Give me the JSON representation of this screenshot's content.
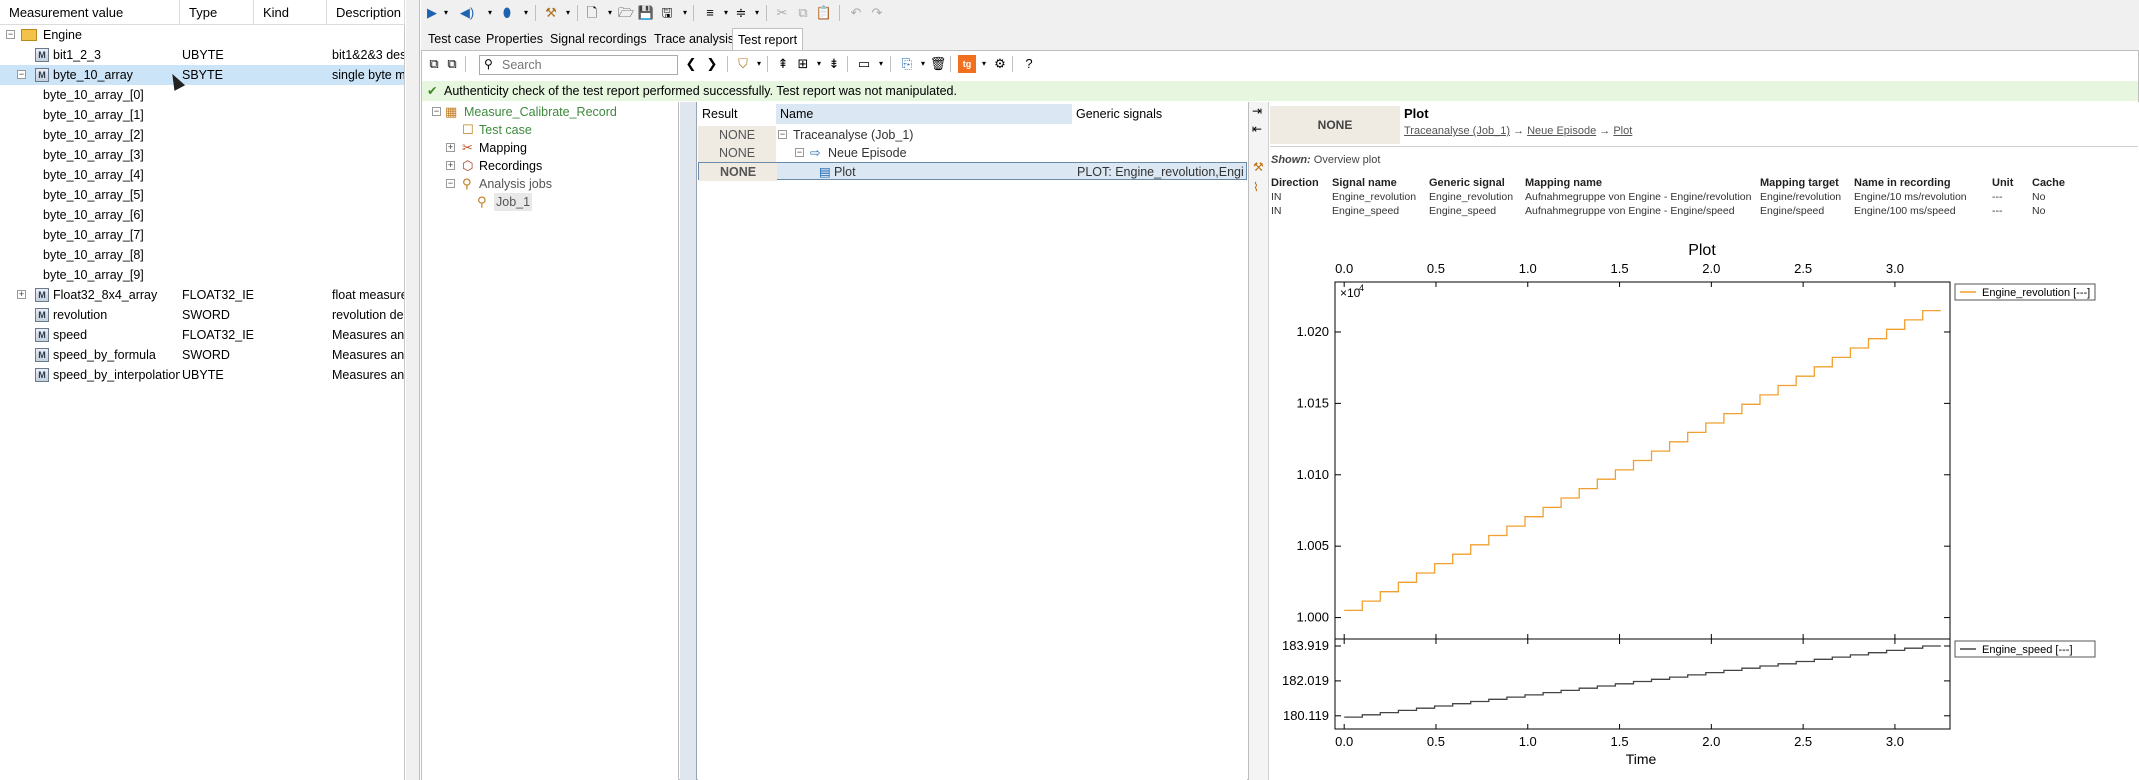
{
  "left_panel": {
    "columns": [
      "Measurement value",
      "Type",
      "Kind",
      "Description"
    ],
    "rows": [
      {
        "name": "Engine",
        "type": "",
        "kind": "",
        "description": "",
        "expander": "⊟",
        "icon": "folder"
      },
      {
        "name": "bit1_2_3",
        "type": "UBYTE",
        "kind": "",
        "description": "bit1&2&3 des",
        "icon": "M"
      },
      {
        "name": "byte_10_array",
        "type": "SBYTE",
        "kind": "",
        "description": "single byte m",
        "expander": "⊟",
        "icon": "M",
        "selected": true
      },
      {
        "name": "byte_10_array_[0]",
        "type": "",
        "kind": "",
        "description": ""
      },
      {
        "name": "byte_10_array_[1]",
        "type": "",
        "kind": "",
        "description": ""
      },
      {
        "name": "byte_10_array_[2]",
        "type": "",
        "kind": "",
        "description": ""
      },
      {
        "name": "byte_10_array_[3]",
        "type": "",
        "kind": "",
        "description": ""
      },
      {
        "name": "byte_10_array_[4]",
        "type": "",
        "kind": "",
        "description": ""
      },
      {
        "name": "byte_10_array_[5]",
        "type": "",
        "kind": "",
        "description": ""
      },
      {
        "name": "byte_10_array_[6]",
        "type": "",
        "kind": "",
        "description": ""
      },
      {
        "name": "byte_10_array_[7]",
        "type": "",
        "kind": "",
        "description": ""
      },
      {
        "name": "byte_10_array_[8]",
        "type": "",
        "kind": "",
        "description": ""
      },
      {
        "name": "byte_10_array_[9]",
        "type": "",
        "kind": "",
        "description": ""
      },
      {
        "name": "Float32_8x4_array",
        "type": "FLOAT32_IE...",
        "kind": "",
        "description": "float measure",
        "expander": "⊞",
        "icon": "M"
      },
      {
        "name": "revolution",
        "type": "SWORD",
        "kind": "",
        "description": "revolution des",
        "icon": "M"
      },
      {
        "name": "speed",
        "type": "FLOAT32_IE...",
        "kind": "",
        "description": "Measures and",
        "icon": "M"
      },
      {
        "name": "speed_by_formula",
        "type": "SWORD",
        "kind": "",
        "description": "Measures and",
        "icon": "M"
      },
      {
        "name": "speed_by_interpolation",
        "type": "UBYTE",
        "kind": "",
        "description": "Measures and",
        "icon": "M"
      }
    ]
  },
  "tabs": [
    "Test case",
    "Properties",
    "Signal recordings",
    "Trace analysis",
    "Test report"
  ],
  "active_tab": "Test report",
  "search": {
    "placeholder": "Search",
    "value": ""
  },
  "auth_message": "Authenticity check of the test report performed successfully. Test report was not manipulated.",
  "tree": [
    {
      "label": "Measure_Calibrate_Record",
      "expander": "⊟"
    },
    {
      "label": "Test case",
      "expander": ""
    },
    {
      "label": "Mapping",
      "expander": "⊞"
    },
    {
      "label": "Recordings",
      "expander": "⊞"
    },
    {
      "label": "Analysis jobs",
      "expander": "⊟"
    },
    {
      "label": "Job_1",
      "expander": ""
    }
  ],
  "results": {
    "columns": [
      "Result",
      "Name",
      "Generic signals"
    ],
    "rows": [
      {
        "result": "NONE",
        "name": "Traceanalyse (Job_1)",
        "generic": "",
        "expander": "⊟"
      },
      {
        "result": "NONE",
        "name": "Neue Episode",
        "generic": "",
        "expander": "⊟"
      },
      {
        "result": "NONE",
        "name": "Plot",
        "generic": "PLOT: Engine_revolution,Engi",
        "expander": ""
      }
    ]
  },
  "detail": {
    "result": "NONE",
    "title": "Plot",
    "breadcrumb": [
      "Traceanalyse (Job_1)",
      "Neue Episode",
      "Plot"
    ],
    "breadcrumb_sep": "→",
    "shown_label": "Shown:",
    "shown_value": "Overview plot",
    "table_columns": [
      "Direction",
      "Signal name",
      "Generic signal",
      "Mapping name",
      "Mapping target",
      "Name in recording",
      "Unit",
      "Cache"
    ],
    "table_rows": [
      [
        "IN",
        "Engine_revolution",
        "Engine_revolution",
        "Aufnahmegruppe von Engine - Engine/revolution",
        "Engine/revolution",
        "Engine/10 ms/revolution",
        "---",
        "No"
      ],
      [
        "IN",
        "Engine_speed",
        "Engine_speed",
        "Aufnahmegruppe von Engine - Engine/speed",
        "Engine/speed",
        "Engine/100 ms/speed",
        "---",
        "No"
      ]
    ]
  },
  "colors": {
    "accent_orange": "#f0a030",
    "speed_line": "#444444",
    "auth_bg": "#e6f6df",
    "selection": "#cce4f7"
  },
  "chart_data": {
    "type": "line",
    "title": "Plot",
    "xlabel": "Time",
    "x_ticks": [
      "0.0",
      "0.5",
      "1.0",
      "1.5",
      "2.0",
      "2.5",
      "3.0"
    ],
    "xlim": [
      -0.05,
      3.3
    ],
    "panels": [
      {
        "name": "Engine_revolution",
        "legend": "Engine_revolution [---]",
        "exponent_label": "×10",
        "exponent_power": "4",
        "ylim": [
          0.9985,
          1.0235
        ],
        "y_ticks": [
          {
            "value": 1.0,
            "label": "1.000"
          },
          {
            "value": 1.005,
            "label": "1.005"
          },
          {
            "value": 1.01,
            "label": "1.010"
          },
          {
            "value": 1.015,
            "label": "1.015"
          },
          {
            "value": 1.02,
            "label": "1.020"
          }
        ],
        "series": {
          "x_start": 0.0,
          "x_end": 3.25,
          "y_start": 1.0005,
          "y_end": 1.0215,
          "steps": 33,
          "color": "#f0a030"
        }
      },
      {
        "name": "Engine_speed",
        "legend": "Engine_speed [---]",
        "ylim": [
          179.4,
          184.3
        ],
        "y_ticks": [
          {
            "value": 180.119,
            "label": "180.119"
          },
          {
            "value": 182.019,
            "label": "182.019"
          },
          {
            "value": 183.919,
            "label": "183.919"
          }
        ],
        "series": {
          "x_start": 0.0,
          "x_end": 3.25,
          "y_start": 180.05,
          "y_end": 183.919,
          "steps": 33,
          "color": "#444444"
        }
      }
    ]
  }
}
